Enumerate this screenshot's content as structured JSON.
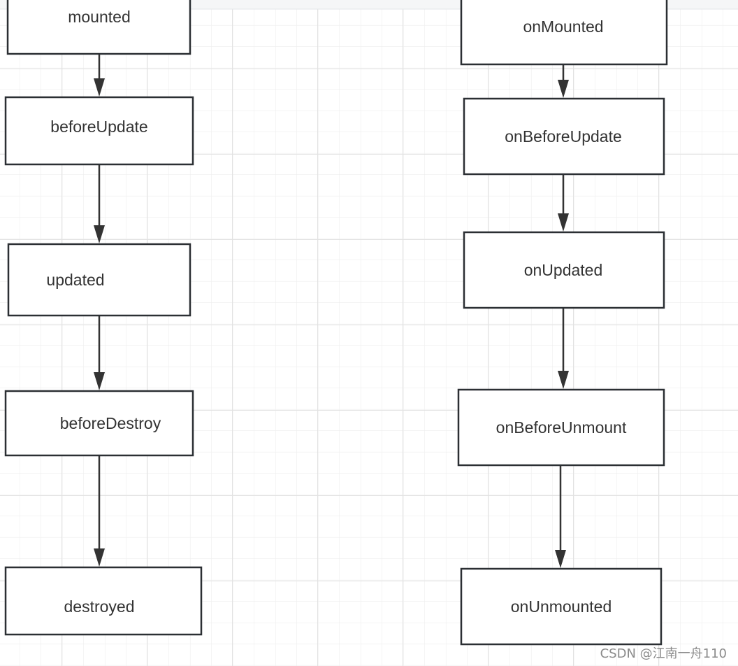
{
  "diagram": {
    "left_column": [
      "mounted",
      "beforeUpdate",
      "updated",
      "beforeDestroy",
      "destroyed"
    ],
    "right_column": [
      "onMounted",
      "onBeforeUpdate",
      "onUpdated",
      "onBeforeUnmount",
      "onUnmounted"
    ]
  },
  "watermark": "CSDN @江南一舟110",
  "colors": {
    "stroke": "#2b2f33",
    "grid": "#e6e6e6",
    "background": "#ffffff"
  }
}
